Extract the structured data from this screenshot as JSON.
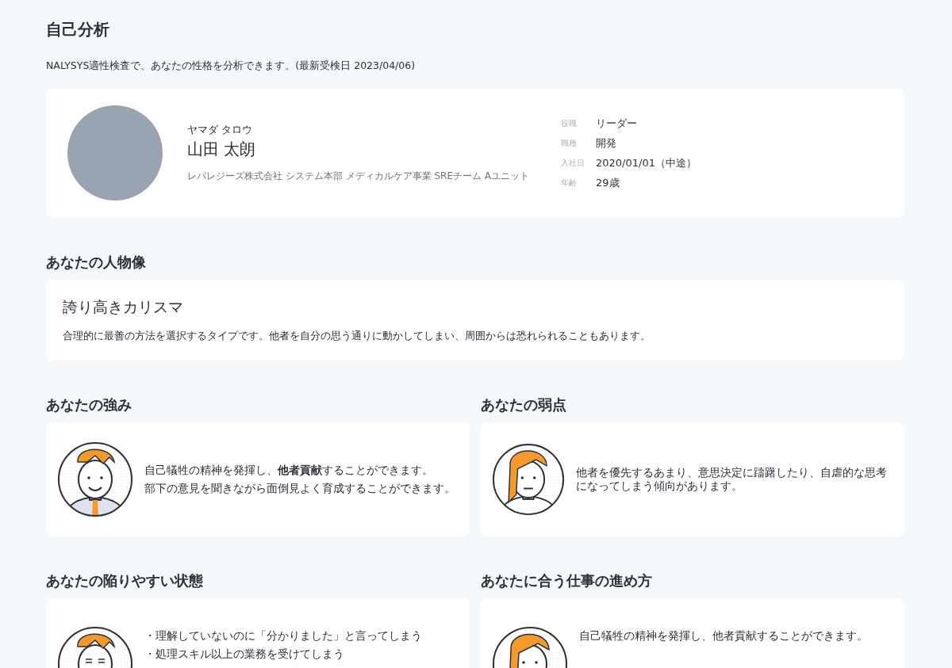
{
  "page": {
    "title": "自己分析",
    "subtitle": "NALYSYS適性検査で、あなたの性格を分析できます。(最新受検日 2023/04/06)"
  },
  "profile": {
    "kana": "ヤマダ タロウ",
    "name": "山田 太朗",
    "department": "レバレジーズ株式会社 システム本部 メディカルケア事業 SREチーム Aユニット",
    "details": [
      {
        "label": "役職",
        "value": "リーダー"
      },
      {
        "label": "職種",
        "value": "開発"
      },
      {
        "label": "入社日",
        "value": "2020/01/01（中途）"
      },
      {
        "label": "年齢",
        "value": "29歳"
      }
    ]
  },
  "persona": {
    "heading": "あなたの人物像",
    "type": "誇り高きカリスマ",
    "description": "合理的に最善の方法を選択するタイプです。他者を自分の思う通りに動かしてしまい、周囲からは恐れられることもあります。"
  },
  "cards": [
    {
      "heading": "あなたの強み",
      "kind": "man-smiling",
      "lines": [
        "自己犠牲の精神を発揮し、**他者貢献**することができます。",
        "部下の意見を聞きながら面倒見よく育成することができます。"
      ]
    },
    {
      "heading": "あなたの弱点",
      "kind": "woman-worried",
      "lines": [
        "他者を優先するあまり、意思決定に躊躇したり、自虐的な思考になってしまう傾向があります。"
      ]
    },
    {
      "heading": "あなたの陥りやすい状態",
      "kind": "man-stressed",
      "lines": [
        "・理解していないのに「分かりました」と言ってしまう",
        "・処理スキル以上の業務を受けてしまう"
      ]
    },
    {
      "heading": "あなたに合う仕事の進め方",
      "kind": "woman-thinking",
      "lines": [
        "自己犠牲の精神を発揮し、他者貢献することができます。"
      ]
    }
  ]
}
